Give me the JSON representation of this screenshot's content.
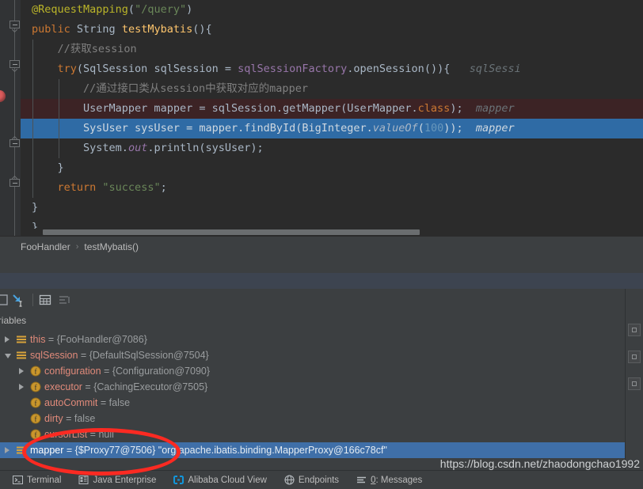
{
  "editor": {
    "lines": [
      {
        "indent": 0,
        "tokens": [
          {
            "t": "@RequestMapping",
            "c": "an"
          },
          {
            "t": "(",
            "c": "p"
          },
          {
            "t": "\"/query\"",
            "c": "s"
          },
          {
            "t": ")",
            "c": "p"
          }
        ]
      },
      {
        "indent": 0,
        "tokens": [
          {
            "t": "public ",
            "c": "k"
          },
          {
            "t": "String ",
            "c": "p"
          },
          {
            "t": "testMybatis",
            "c": "m"
          },
          {
            "t": "(){",
            "c": "p"
          }
        ]
      },
      {
        "indent": 1,
        "tokens": [
          {
            "t": "//获取session",
            "c": "cm"
          }
        ]
      },
      {
        "indent": 1,
        "tokens": [
          {
            "t": "try",
            "c": "k"
          },
          {
            "t": "(SqlSession sqlSession = ",
            "c": "p"
          },
          {
            "t": "sqlSessionFactory",
            "c": "f"
          },
          {
            "t": ".openSession()){",
            "c": "p"
          },
          {
            "t": "   sqlSessi",
            "c": "hint"
          }
        ]
      },
      {
        "indent": 2,
        "tokens": [
          {
            "t": "//通过接口类从session中获取对应的mapper",
            "c": "cm"
          }
        ]
      },
      {
        "indent": 2,
        "tokens": [
          {
            "t": "UserMapper mapper = sqlSession.getMapper(UserMapper.",
            "c": "p"
          },
          {
            "t": "class",
            "c": "k"
          },
          {
            "t": ");",
            "c": "p"
          },
          {
            "t": "  mapper",
            "c": "hint"
          }
        ]
      },
      {
        "indent": 2,
        "tokens": [
          {
            "t": "SysUser sysUser = mapper.findById(BigInteger.",
            "c": "p"
          },
          {
            "t": "valueOf",
            "c": "si"
          },
          {
            "t": "(",
            "c": "p"
          },
          {
            "t": "100",
            "c": "n"
          },
          {
            "t": "));",
            "c": "p"
          },
          {
            "t": "  mapper",
            "c": "hint"
          }
        ]
      },
      {
        "indent": 2,
        "tokens": [
          {
            "t": "System.",
            "c": "p"
          },
          {
            "t": "out",
            "c": "fi"
          },
          {
            "t": ".println(sysUser);",
            "c": "p"
          }
        ]
      },
      {
        "indent": 1,
        "tokens": [
          {
            "t": "}",
            "c": "p"
          }
        ]
      },
      {
        "indent": 1,
        "tokens": [
          {
            "t": "return ",
            "c": "k"
          },
          {
            "t": "\"success\"",
            "c": "s"
          },
          {
            "t": ";",
            "c": "p"
          }
        ]
      },
      {
        "indent": 0,
        "tokens": [
          {
            "t": "}",
            "c": "p"
          }
        ]
      },
      {
        "indent": -1,
        "tokens": [
          {
            "t": "}",
            "c": "p"
          }
        ]
      }
    ],
    "breakpoint_line_index": 5,
    "executing_line_index": 6,
    "scroll_position": "horizontal"
  },
  "breadcrumb": {
    "class_name": "FooHandler",
    "separator": "›",
    "method_name": "testMybatis()"
  },
  "debugger": {
    "toolbar": {
      "icons": [
        {
          "name": "evaluate-expression-icon",
          "label": "Evaluate Expression"
        },
        {
          "name": "step-into-icon",
          "label": "Step Into"
        },
        {
          "name": "view-as-table-icon",
          "label": "View as Table"
        },
        {
          "name": "sort-values-icon",
          "label": "Sort values"
        }
      ]
    },
    "panel_title": "Variables",
    "tree": [
      {
        "depth": 0,
        "twisty": "collapsed",
        "icon": "object-icon",
        "name": "this",
        "eq": " = ",
        "value": "{FooHandler@7086}",
        "selected": false
      },
      {
        "depth": 0,
        "twisty": "expanded",
        "icon": "object-icon",
        "name": "sqlSession",
        "eq": " = ",
        "value": "{DefaultSqlSession@7504}",
        "selected": false
      },
      {
        "depth": 1,
        "twisty": "collapsed",
        "icon": "field-icon",
        "name": "configuration",
        "eq": " = ",
        "value": "{Configuration@7090}",
        "selected": false
      },
      {
        "depth": 1,
        "twisty": "collapsed",
        "icon": "field-icon",
        "name": "executor",
        "eq": " = ",
        "value": "{CachingExecutor@7505}",
        "selected": false
      },
      {
        "depth": 1,
        "twisty": "none",
        "icon": "field-icon",
        "name": "autoCommit",
        "eq": " = ",
        "value": "false",
        "selected": false
      },
      {
        "depth": 1,
        "twisty": "none",
        "icon": "field-icon",
        "name": "dirty",
        "eq": " = ",
        "value": "false",
        "selected": false
      },
      {
        "depth": 1,
        "twisty": "none",
        "icon": "field-icon",
        "name": "cursorList",
        "eq": " = ",
        "value": "null",
        "selected": false
      },
      {
        "depth": 0,
        "twisty": "collapsed",
        "icon": "object-icon",
        "name": "mapper",
        "eq": " = ",
        "value": "{$Proxy77@7506} \"org.apache.ibatis.binding.MapperProxy@166c78cf\"",
        "selected": true
      }
    ]
  },
  "statusbar": {
    "items": [
      {
        "icon": "terminal-icon",
        "label": "Terminal"
      },
      {
        "icon": "java-enterprise-icon",
        "label": "Java Enterprise"
      },
      {
        "icon": "alibaba-cloud-icon",
        "label": "Alibaba Cloud View"
      },
      {
        "icon": "endpoints-icon",
        "label": "Endpoints"
      },
      {
        "icon": "messages-icon",
        "label": "0: Messages",
        "underline_first": "0"
      }
    ]
  },
  "watermark": {
    "text": "https://blog.csdn.net/zhaodongchao1992"
  },
  "annotations": {
    "ellipse_color": "#fb2a22",
    "target": "mapper"
  },
  "colors": {
    "editor_bg": "#2b2b2b",
    "panel_bg": "#3c3f41",
    "selection_blue": "#3f6fa8",
    "exec_line_blue": "#2f6ba5",
    "breakpoint_row_red": "#3c2325",
    "keyword_orange": "#cc7832",
    "string_green": "#6a8759",
    "annotation_olive": "#bbb529",
    "method_yellow": "#ffc66d",
    "number_blue": "#6897bb",
    "field_purple": "#9876aa",
    "var_name_red": "#e08a7a"
  }
}
